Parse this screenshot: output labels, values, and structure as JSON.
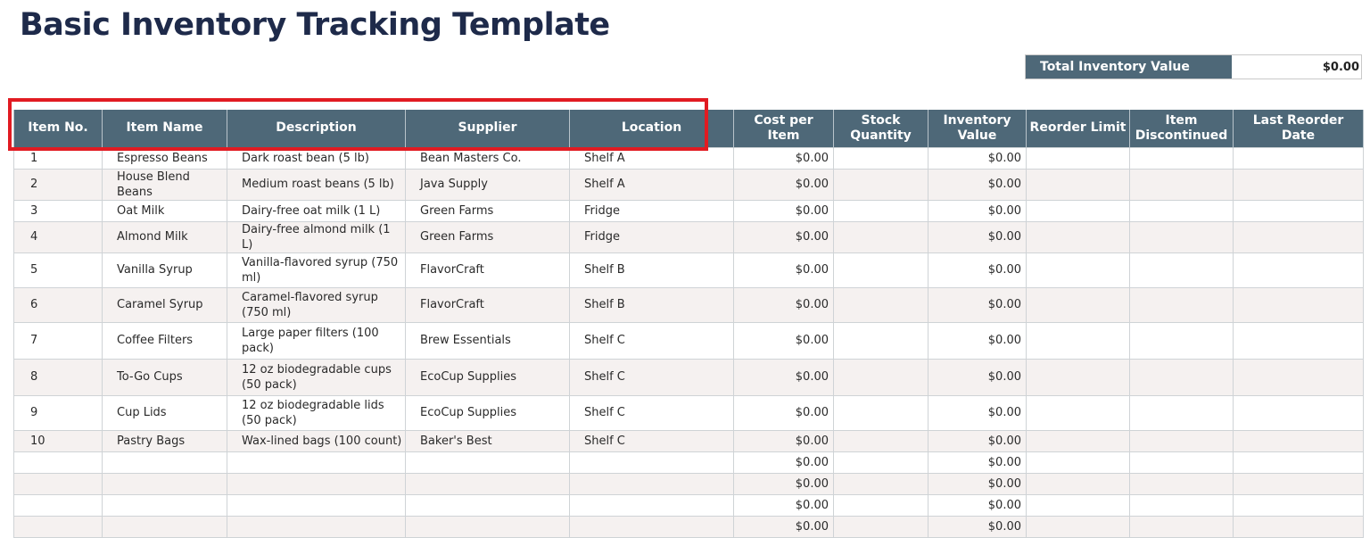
{
  "title": "Basic Inventory Tracking Template",
  "summary": {
    "label": "Total Inventory Value",
    "value": "$0.00"
  },
  "columns": [
    "Item No.",
    "Item Name",
    "Description",
    "Supplier",
    "Location",
    "Cost per Item",
    "Stock Quantity",
    "Inventory Value",
    "Reorder Limit",
    "Item Discontinued",
    "Last Reorder Date"
  ],
  "rows": [
    {
      "no": "1",
      "name": "Espresso Beans",
      "desc": "Dark roast bean (5 lb)",
      "supplier": "Bean Masters Co.",
      "location": "Shelf A",
      "cost": "$0.00",
      "qty": "",
      "value": "$0.00",
      "reorder": "",
      "discontinued": "",
      "last": ""
    },
    {
      "no": "2",
      "name": "House Blend Beans",
      "desc": "Medium roast beans (5 lb)",
      "supplier": "Java Supply",
      "location": "Shelf A",
      "cost": "$0.00",
      "qty": "",
      "value": "$0.00",
      "reorder": "",
      "discontinued": "",
      "last": ""
    },
    {
      "no": "3",
      "name": "Oat Milk",
      "desc": "Dairy-free oat milk (1 L)",
      "supplier": "Green Farms",
      "location": "Fridge",
      "cost": "$0.00",
      "qty": "",
      "value": "$0.00",
      "reorder": "",
      "discontinued": "",
      "last": ""
    },
    {
      "no": "4",
      "name": "Almond Milk",
      "desc": "Dairy-free almond milk (1 L)",
      "supplier": "Green Farms",
      "location": "Fridge",
      "cost": "$0.00",
      "qty": "",
      "value": "$0.00",
      "reorder": "",
      "discontinued": "",
      "last": ""
    },
    {
      "no": "5",
      "name": "Vanilla Syrup",
      "desc": "Vanilla-flavored syrup (750 ml)",
      "supplier": "FlavorCraft",
      "location": "Shelf B",
      "cost": "$0.00",
      "qty": "",
      "value": "$0.00",
      "reorder": "",
      "discontinued": "",
      "last": ""
    },
    {
      "no": "6",
      "name": "Caramel Syrup",
      "desc": "Caramel-flavored syrup (750 ml)",
      "supplier": "FlavorCraft",
      "location": "Shelf B",
      "cost": "$0.00",
      "qty": "",
      "value": "$0.00",
      "reorder": "",
      "discontinued": "",
      "last": ""
    },
    {
      "no": "7",
      "name": "Coffee Filters",
      "desc": "Large paper filters (100 pack)",
      "supplier": "Brew Essentials",
      "location": "Shelf C",
      "cost": "$0.00",
      "qty": "",
      "value": "$0.00",
      "reorder": "",
      "discontinued": "",
      "last": ""
    },
    {
      "no": "8",
      "name": "To-Go Cups",
      "desc": "12 oz biodegradable cups (50 pack)",
      "supplier": "EcoCup Supplies",
      "location": "Shelf C",
      "cost": "$0.00",
      "qty": "",
      "value": "$0.00",
      "reorder": "",
      "discontinued": "",
      "last": ""
    },
    {
      "no": "9",
      "name": "Cup Lids",
      "desc": "12 oz biodegradable lids (50 pack)",
      "supplier": "EcoCup Supplies",
      "location": "Shelf C",
      "cost": "$0.00",
      "qty": "",
      "value": "$0.00",
      "reorder": "",
      "discontinued": "",
      "last": ""
    },
    {
      "no": "10",
      "name": "Pastry Bags",
      "desc": "Wax-lined bags (100 count)",
      "supplier": "Baker's Best",
      "location": "Shelf C",
      "cost": "$0.00",
      "qty": "",
      "value": "$0.00",
      "reorder": "",
      "discontinued": "",
      "last": ""
    },
    {
      "no": "",
      "name": "",
      "desc": "",
      "supplier": "",
      "location": "",
      "cost": "$0.00",
      "qty": "",
      "value": "$0.00",
      "reorder": "",
      "discontinued": "",
      "last": ""
    },
    {
      "no": "",
      "name": "",
      "desc": "",
      "supplier": "",
      "location": "",
      "cost": "$0.00",
      "qty": "",
      "value": "$0.00",
      "reorder": "",
      "discontinued": "",
      "last": ""
    },
    {
      "no": "",
      "name": "",
      "desc": "",
      "supplier": "",
      "location": "",
      "cost": "$0.00",
      "qty": "",
      "value": "$0.00",
      "reorder": "",
      "discontinued": "",
      "last": ""
    },
    {
      "no": "",
      "name": "",
      "desc": "",
      "supplier": "",
      "location": "",
      "cost": "$0.00",
      "qty": "",
      "value": "$0.00",
      "reorder": "",
      "discontinued": "",
      "last": ""
    }
  ],
  "colors": {
    "header_bg": "#4e6878",
    "title": "#1e2a4a",
    "alt_row": "#f5f1f0",
    "highlight": "#e11b22"
  }
}
